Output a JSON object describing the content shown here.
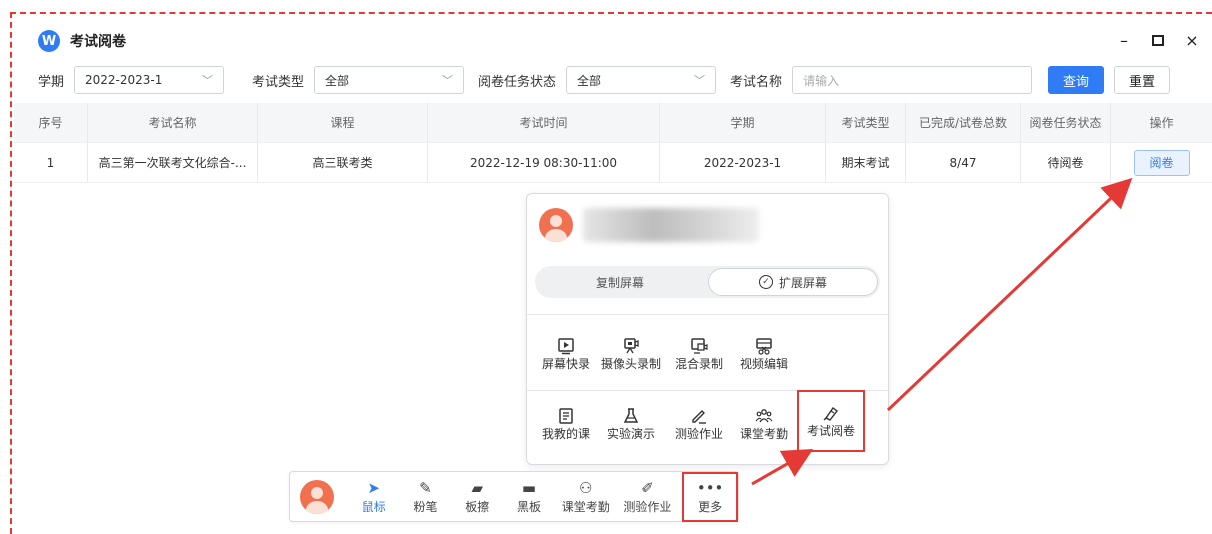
{
  "window": {
    "title": "考试阅卷",
    "logo_letter": "W",
    "controls": [
      "–",
      "×"
    ]
  },
  "filters": {
    "term_label": "学期",
    "term_value": "2022-2023-1",
    "exam_type_label": "考试类型",
    "exam_type_value": "全部",
    "task_status_label": "阅卷任务状态",
    "task_status_value": "全部",
    "exam_name_label": "考试名称",
    "exam_name_placeholder": "请输入",
    "query_button": "查询",
    "reset_button": "重置"
  },
  "table": {
    "columns": [
      "序号",
      "考试名称",
      "课程",
      "考试时间",
      "学期",
      "考试类型",
      "已完成/试卷总数",
      "阅卷任务状态",
      "操作"
    ],
    "rows": [
      {
        "index": "1",
        "exam_name": "高三第一次联考文化综合-...",
        "course": "高三联考类",
        "time": "2022-12-19 08:30-11:00",
        "term": "2022-2023-1",
        "exam_type": "期末考试",
        "progress": "8/47",
        "status": "待阅卷",
        "action": "阅卷"
      }
    ]
  },
  "popup": {
    "mirror_label": "复制屏幕",
    "extend_label": "扩展屏幕",
    "row1": [
      "屏幕快录",
      "摄像头录制",
      "混合录制",
      "视频编辑"
    ],
    "row2": [
      "我教的课",
      "实验演示",
      "测验作业",
      "课堂考勤",
      "考试阅卷"
    ]
  },
  "toolbar": {
    "items": [
      "鼠标",
      "粉笔",
      "板擦",
      "黑板",
      "课堂考勤",
      "测验作业",
      "更多"
    ]
  },
  "colors": {
    "accent": "#2f7cf6",
    "highlight": "#e53935"
  }
}
